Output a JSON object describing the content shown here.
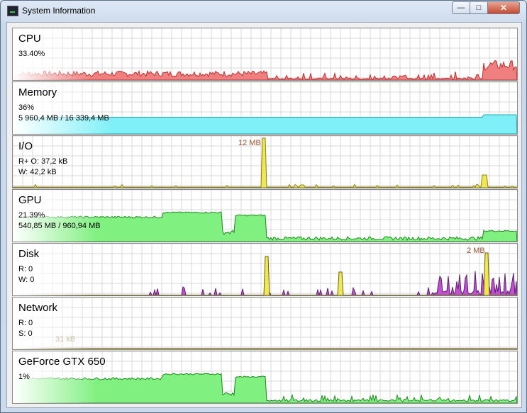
{
  "window": {
    "title": "System Information",
    "icon": "monitor-icon"
  },
  "controls": {
    "minimize": "minimize-icon",
    "maximize": "maximize-icon",
    "close": "close-icon"
  },
  "panels": {
    "cpu": {
      "title": "CPU",
      "line1": "33.40%",
      "fill": "#f08080",
      "stroke": "#c03030"
    },
    "memory": {
      "title": "Memory",
      "line1": "36%",
      "line2": "5 960,4 MB / 16 339,4 MB",
      "fill": "#80f0f8",
      "stroke": "#20a8b8"
    },
    "io": {
      "title": "I/O",
      "line1": "R+ O: 37,2 kB",
      "line2": "W: 42,2 kB",
      "peak": "12 MB",
      "fill": "#f0e850",
      "stroke": "#8a8020"
    },
    "gpu": {
      "title": "GPU",
      "line1": "21.39%",
      "line2": "540,85 MB / 960,94 MB",
      "fill": "#80f080",
      "stroke": "#1a8a1a"
    },
    "disk": {
      "title": "Disk",
      "line1": "R: 0",
      "line2": "W: 0",
      "peak": "2 MB",
      "fill_read": "#f0e850",
      "fill_write": "#c050d0"
    },
    "network": {
      "title": "Network",
      "line1": "R: 0",
      "line2": "S: 0",
      "peak": "31 kB"
    },
    "geforce": {
      "title": "GeForce GTX 650",
      "line1": "1%",
      "fill": "#80f080",
      "stroke": "#1a8a1a"
    }
  }
}
